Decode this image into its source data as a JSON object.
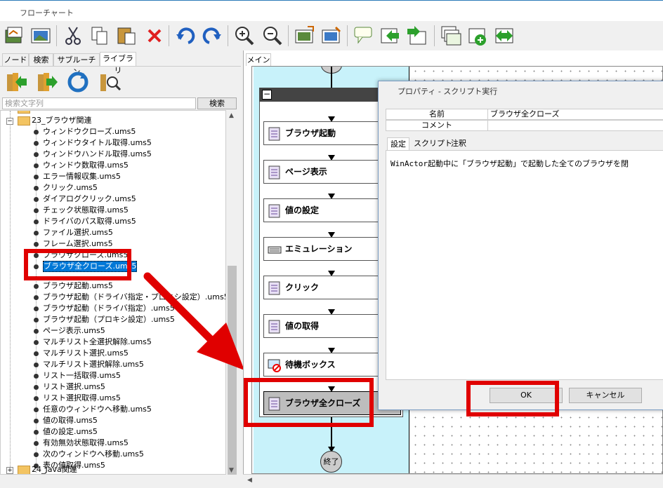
{
  "window": {
    "title": "フローチャート"
  },
  "toolbar": {
    "icons": [
      "open-icon",
      "image-icon",
      "cut-icon",
      "copy-icon",
      "paste-icon",
      "delete-icon",
      "undo-icon",
      "redo-icon",
      "zoom-in-icon",
      "zoom-out-icon",
      "image-capture-icon",
      "image-edit-icon",
      "comment-icon",
      "subroutine-icon",
      "step-in-icon",
      "windows-icon",
      "add-icon",
      "swap-icon"
    ]
  },
  "left_panel": {
    "tabs": [
      "ノード",
      "検索",
      "サブルーチン",
      "ライブラリ"
    ],
    "active_tab": "ライブラリ",
    "search": {
      "placeholder": "検索文字列",
      "button": "検索"
    },
    "folder_top": "23_ブラウザ関連",
    "folder_bottom": "24_Java関連",
    "items": [
      "ウィンドウクローズ.ums5",
      "ウィンドウタイトル取得.ums5",
      "ウィンドウハンドル取得.ums5",
      "ウィンドウ数取得.ums5",
      "エラー情報収集.ums5",
      "クリック.ums5",
      "ダイアログクリック.ums5",
      "チェック状態取得.ums5",
      "ドライバのパス取得.ums5",
      "ファイル選択.ums5",
      "フレーム選択.ums5",
      "ブラウザクローズ.ums5",
      "ブラウザ全クローズ.ums5",
      "ブラウザ起動.ums5",
      "ブラウザ起動（ドライバ指定・プロキシ設定）.ums5",
      "ブラウザ起動（ドライバ指定）.ums5",
      "ブラウザ起動（プロキシ設定）.ums5",
      "ページ表示.ums5",
      "マルチリスト全選択解除.ums5",
      "マルチリスト選択.ums5",
      "マルチリスト選択解除.ums5",
      "リスト一括取得.ums5",
      "リスト選択.ums5",
      "リスト選択取得.ums5",
      "任意のウィンドウへ移動.ums5",
      "値の取得.ums5",
      "値の設定.ums5",
      "有効無効状態取得.ums5",
      "次のウィンドウへ移動.ums5",
      "表の値取得.ums5"
    ],
    "selected": "ブラウザ全クローズ.ums5"
  },
  "flowchart": {
    "tab": "メイン",
    "nodes": [
      "ブラウザ起動",
      "ページ表示",
      "値の設定",
      "エミュレーション",
      "クリック",
      "値の取得",
      "待機ボックス",
      "ブラウザ全クローズ"
    ],
    "end_label": "終了"
  },
  "dialog": {
    "title": "プロパティ - スクリプト実行",
    "rows": [
      {
        "key": "名前",
        "value": "ブラウザ全クローズ"
      },
      {
        "key": "コメント",
        "value": ""
      }
    ],
    "tabs": [
      "設定",
      "スクリプト",
      "注釈"
    ],
    "active_tab": "設定",
    "description": "WinActor起動中に「ブラウザ起動」で起動した全てのブラウザを閉",
    "ok": "OK",
    "cancel": "キャンセル"
  },
  "colors": {
    "highlight": "#e00000",
    "lane": "#c8f2fa",
    "selection": "#0078d7"
  }
}
